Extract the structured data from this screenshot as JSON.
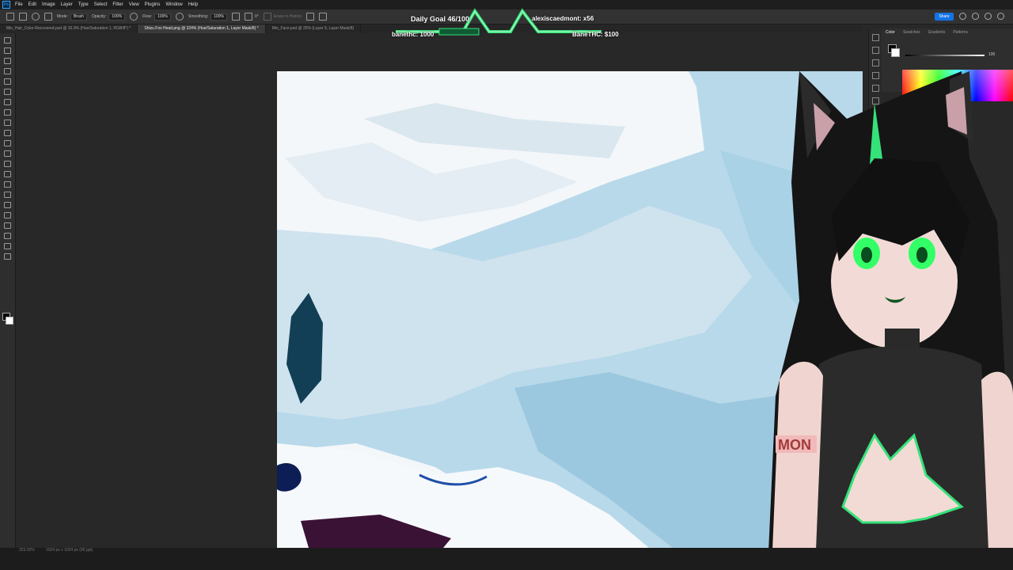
{
  "menubar": {
    "app_icon": "Ps",
    "items": [
      "File",
      "Edit",
      "Image",
      "Layer",
      "Type",
      "Select",
      "Filter",
      "View",
      "Plugins",
      "Window",
      "Help"
    ]
  },
  "options": {
    "mode_label": "Mode:",
    "mode_value": "Brush",
    "opacity_label": "Opacity:",
    "opacity_value": "100%",
    "flow_label": "Flow:",
    "flow_value": "100%",
    "smoothing_label": "Smoothing:",
    "smoothing_value": "100%",
    "angle_value": "0°",
    "erase_history_label": "Erase to History",
    "share_label": "Share"
  },
  "tabs": [
    {
      "label": "Mio_Hair_Color-Recovered.psd @ 33.9% (Hue/Saturation 1, RGB/8*) *",
      "active": false
    },
    {
      "label": "Shizu Fox Head.png @ 324% (Hue/Saturation 1, Layer Mask/8) *",
      "active": true
    },
    {
      "label": "Mio_Face.psd @ 25% (Layer 9, Layer Mask/8)",
      "active": false
    }
  ],
  "panel": {
    "tabs": [
      "Color",
      "Swatches",
      "Gradients",
      "Patterns"
    ],
    "value": "100"
  },
  "status": {
    "zoom": "323.02%",
    "docinfo": "1024 px x 1024 px (96 ppi)"
  },
  "overlay": {
    "goal": "Daily Goal 46/100",
    "subs": "alexiscaedmont: x56",
    "banethc": "banethc: 1000",
    "banethc_money": "BaneTHC: $100",
    "accent": "#35e27a"
  }
}
